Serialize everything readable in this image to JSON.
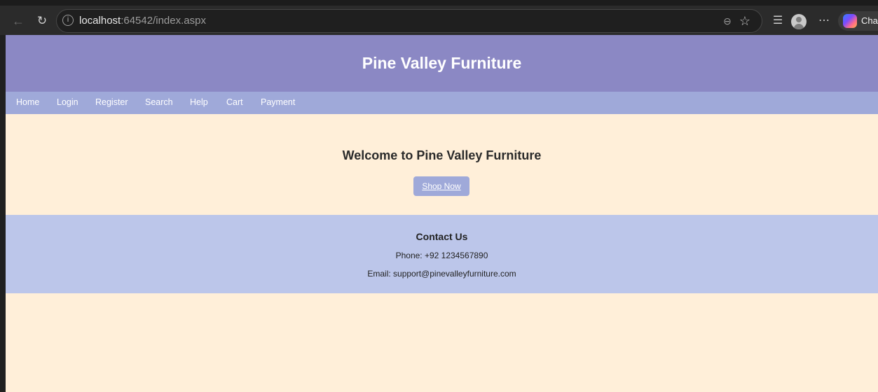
{
  "browser": {
    "url_host": "localhost",
    "url_rest": ":64542/index.aspx",
    "copilot_label": "Chat",
    "icons": {
      "back": "arrow-left",
      "reload": "reload",
      "info": "info-circle",
      "zoom": "zoom-out",
      "star": "star-outline",
      "favorites": "favorites",
      "profile": "user",
      "more": "ellipsis",
      "copilot": "copilot"
    }
  },
  "site": {
    "title": "Pine Valley Furniture",
    "nav": [
      "Home",
      "Login",
      "Register",
      "Search",
      "Help",
      "Cart",
      "Payment"
    ],
    "hero": {
      "heading": "Welcome to Pine Valley Furniture",
      "button": "Shop Now"
    },
    "contact": {
      "heading": "Contact Us",
      "phone": "Phone: +92 1234567890",
      "email": "Email: support@pinevalleyfurniture.com"
    }
  },
  "colors": {
    "header": "#8b88c4",
    "nav": "#9fa9d9",
    "body": "#ffefd9",
    "contact": "#bcc6ea",
    "button": "#9fa9d9"
  }
}
